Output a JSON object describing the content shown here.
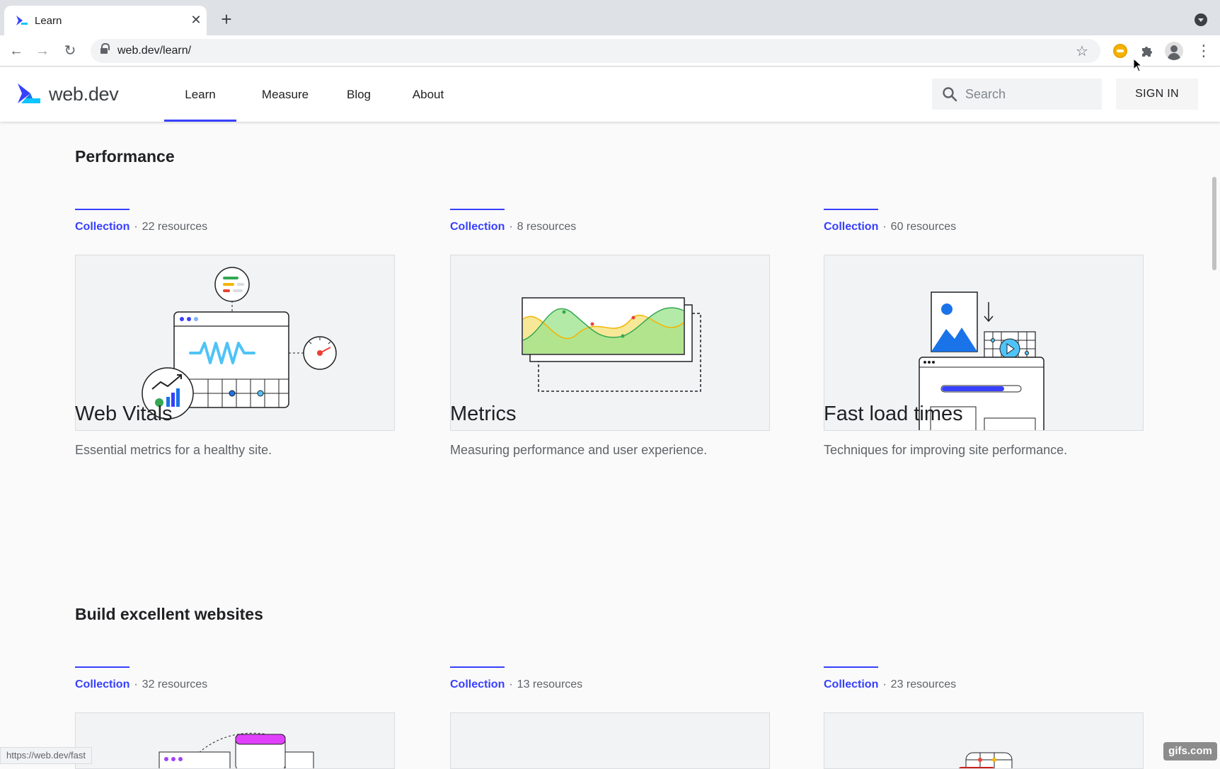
{
  "browser": {
    "tab_title": "Learn",
    "url_domain": "web.dev",
    "url_path": "/learn/",
    "status_url": "https://web.dev/fast"
  },
  "site": {
    "logo_text": "web.dev",
    "nav": [
      "Learn",
      "Measure",
      "Blog",
      "About"
    ],
    "search_placeholder": "Search",
    "signin_label": "SIGN IN"
  },
  "sections": [
    {
      "title": "Performance",
      "cards": [
        {
          "type": "Collection",
          "count": "22 resources",
          "title": "Web Vitals",
          "description": "Essential metrics for a healthy site.",
          "illustration": "web-vitals"
        },
        {
          "type": "Collection",
          "count": "8 resources",
          "title": "Metrics",
          "description": "Measuring performance and user experience.",
          "illustration": "metrics-chart"
        },
        {
          "type": "Collection",
          "count": "60 resources",
          "title": "Fast load times",
          "description": "Techniques for improving site performance.",
          "illustration": "fast-load"
        }
      ]
    },
    {
      "title": "Build excellent websites",
      "cards": [
        {
          "type": "Collection",
          "count": "32 resources"
        },
        {
          "type": "Collection",
          "count": "13 resources"
        },
        {
          "type": "Collection",
          "count": "23 resources"
        }
      ]
    }
  ],
  "watermark": "gifs.com",
  "colors": {
    "accent": "#3740ff",
    "text": "#202124",
    "muted": "#5f6368"
  }
}
